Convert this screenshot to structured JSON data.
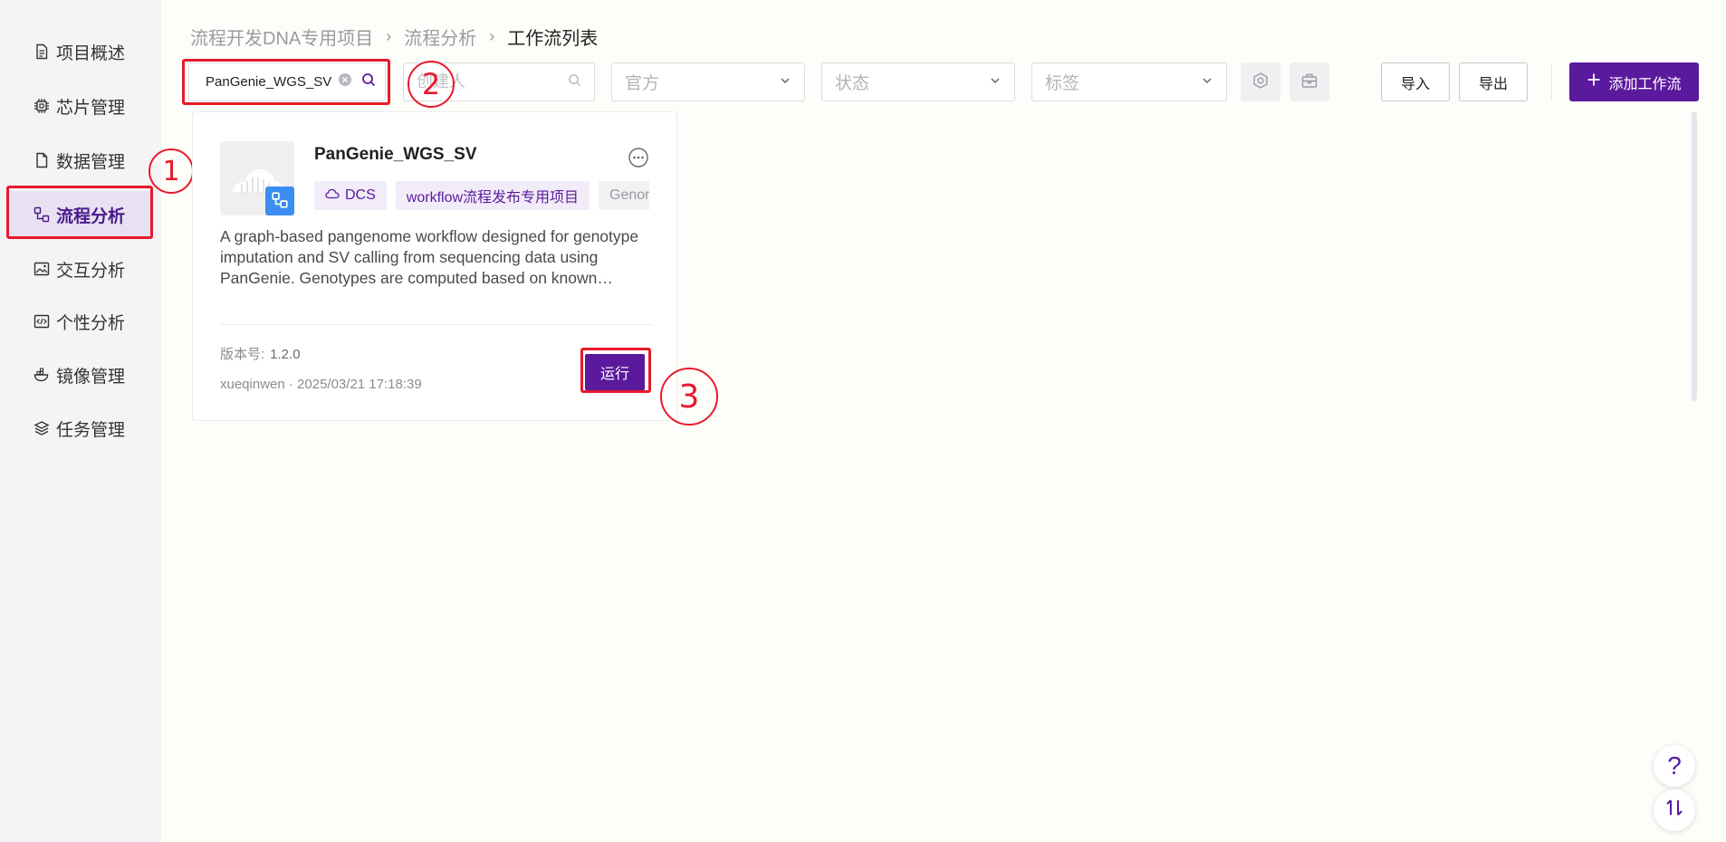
{
  "sidebar": {
    "items": [
      {
        "label": "项目概述",
        "icon": "document-icon"
      },
      {
        "label": "芯片管理",
        "icon": "chip-icon"
      },
      {
        "label": "数据管理",
        "icon": "file-icon"
      },
      {
        "label": "流程分析",
        "icon": "workflow-icon",
        "active": true
      },
      {
        "label": "交互分析",
        "icon": "image-icon"
      },
      {
        "label": "个性分析",
        "icon": "code-icon"
      },
      {
        "label": "镜像管理",
        "icon": "docker-icon"
      },
      {
        "label": "任务管理",
        "icon": "layers-icon"
      }
    ]
  },
  "breadcrumb": {
    "items": [
      "流程开发DNA专用项目",
      "流程分析",
      "工作流列表"
    ]
  },
  "filters": {
    "search_value": "PanGenie_WGS_SV",
    "creator_placeholder": "创建人",
    "official_placeholder": "官方",
    "status_placeholder": "状态",
    "tag_placeholder": "标签"
  },
  "toolbar": {
    "import_label": "导入",
    "export_label": "导出",
    "add_label": "添加工作流"
  },
  "card": {
    "title": "PanGenie_WGS_SV",
    "tags": [
      "DCS",
      "workflow流程发布专用项目",
      "Genome"
    ],
    "description": "A graph-based pangenome workflow designed for genotype imputation and SV calling from sequencing data using PanGenie. Genotypes are computed based on known variants and k-mer counts.",
    "version_label": "版本号:",
    "version": "1.2.0",
    "author_line": "xueqinwen · 2025/03/21 17:18:39",
    "run_label": "运行"
  },
  "annotations": [
    "1",
    "2",
    "3"
  ],
  "colors": {
    "accent": "#5b1a9e",
    "annotation": "#e8192c",
    "badge_blue": "#3b8ef0"
  }
}
